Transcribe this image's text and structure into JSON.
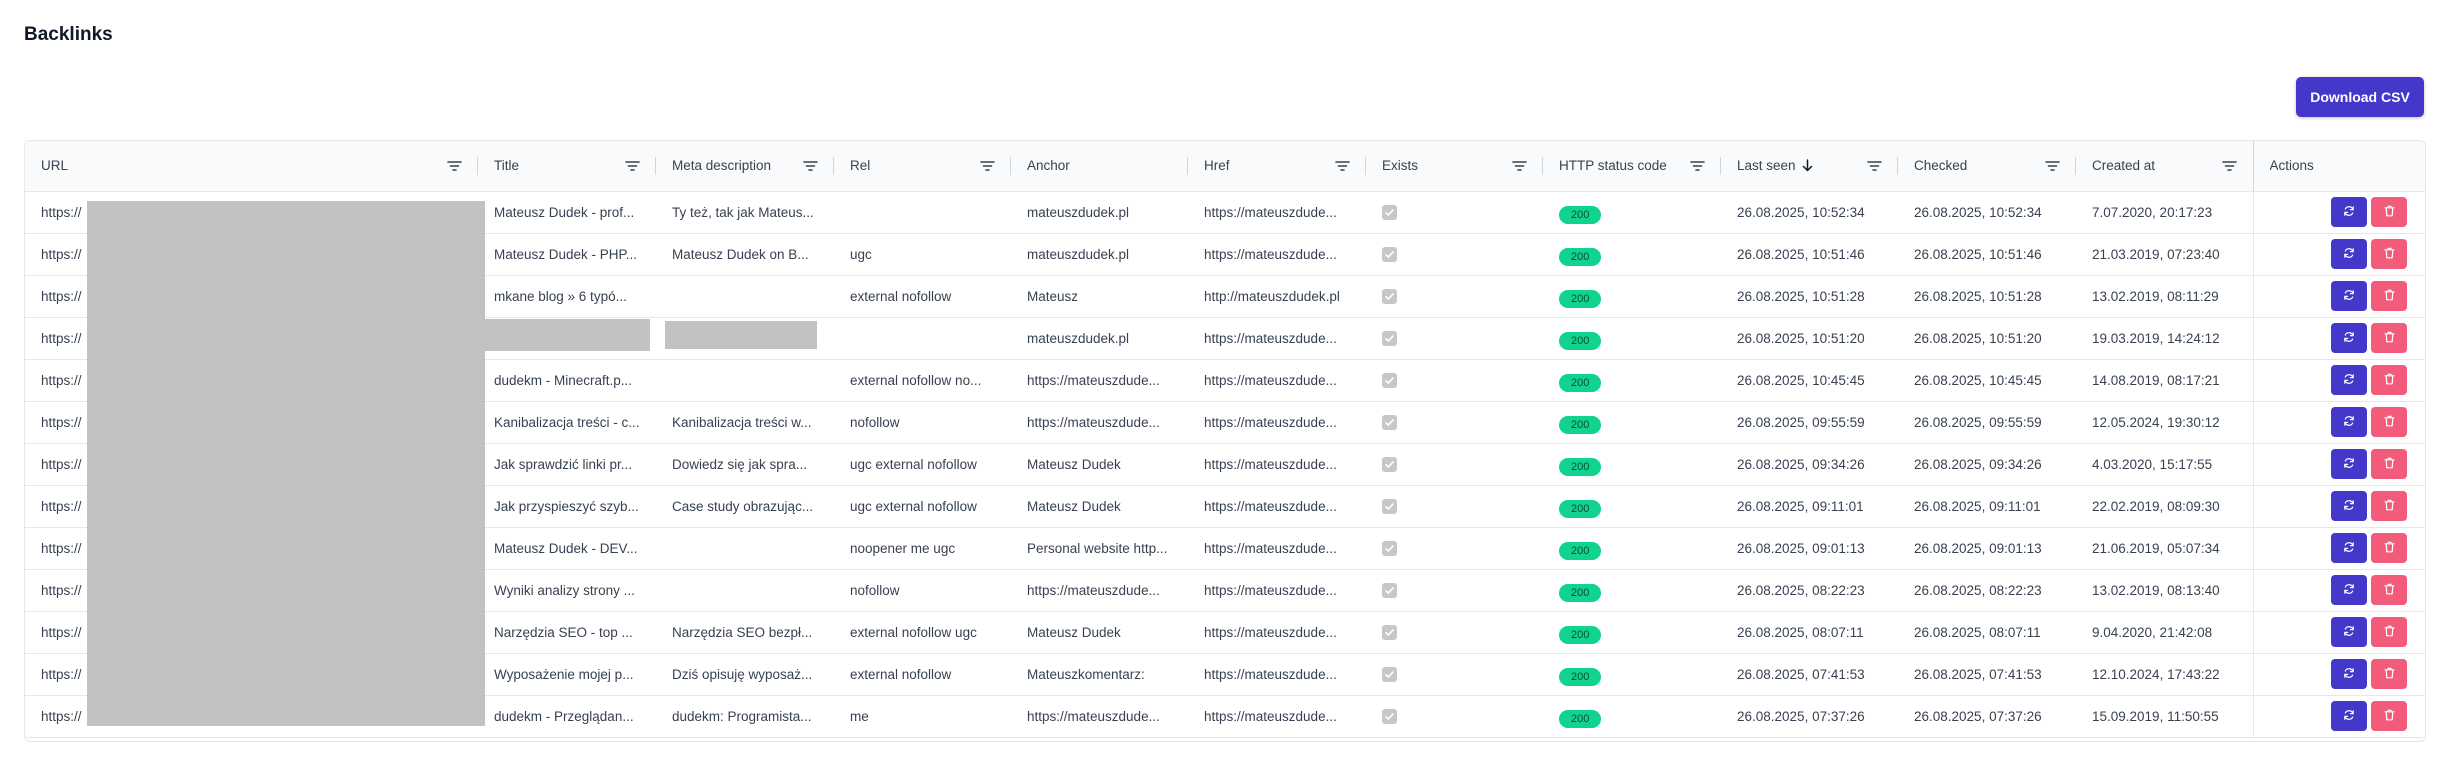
{
  "page": {
    "title": "Backlinks",
    "download_label": "Download CSV"
  },
  "colors": {
    "primary": "#4338ca",
    "danger": "#f25c7a",
    "status_ok": "#10d48e"
  },
  "columns": [
    {
      "key": "url",
      "label": "URL",
      "filter": true
    },
    {
      "key": "title",
      "label": "Title",
      "filter": true
    },
    {
      "key": "meta",
      "label": "Meta description",
      "filter": true
    },
    {
      "key": "rel",
      "label": "Rel",
      "filter": true
    },
    {
      "key": "anchor",
      "label": "Anchor",
      "filter": false
    },
    {
      "key": "href",
      "label": "Href",
      "filter": true
    },
    {
      "key": "exists",
      "label": "Exists",
      "filter": true
    },
    {
      "key": "status",
      "label": "HTTP status code",
      "filter": true
    },
    {
      "key": "last_seen",
      "label": "Last seen",
      "filter": true,
      "sort": "desc"
    },
    {
      "key": "checked",
      "label": "Checked",
      "filter": true
    },
    {
      "key": "created",
      "label": "Created at",
      "filter": true
    },
    {
      "key": "actions",
      "label": "Actions",
      "filter": false
    }
  ],
  "rows": [
    {
      "url": "https://",
      "title": "Mateusz Dudek - prof...",
      "meta": "Ty też, tak jak Mateus...",
      "rel": "",
      "anchor": "mateuszdudek.pl",
      "href": "https://mateuszdude...",
      "exists": true,
      "status": "200",
      "last_seen": "26.08.2025, 10:52:34",
      "checked": "26.08.2025, 10:52:34",
      "created": "7.07.2020, 20:17:23"
    },
    {
      "url": "https://",
      "title": "Mateusz Dudek - PHP...",
      "meta": "Mateusz Dudek on B...",
      "rel": "ugc",
      "anchor": "mateuszdudek.pl",
      "href": "https://mateuszdude...",
      "exists": true,
      "status": "200",
      "last_seen": "26.08.2025, 10:51:46",
      "checked": "26.08.2025, 10:51:46",
      "created": "21.03.2019, 07:23:40"
    },
    {
      "url": "https://",
      "title": "mkane blog » 6 typó...",
      "meta": "",
      "rel": "external nofollow",
      "anchor": "Mateusz",
      "href": "http://mateuszdudek.pl",
      "exists": true,
      "status": "200",
      "last_seen": "26.08.2025, 10:51:28",
      "checked": "26.08.2025, 10:51:28",
      "created": "13.02.2019, 08:11:29"
    },
    {
      "url": "https://",
      "title": "",
      "meta": "",
      "rel": "",
      "anchor": "mateuszdudek.pl",
      "href": "https://mateuszdude...",
      "exists": true,
      "status": "200",
      "last_seen": "26.08.2025, 10:51:20",
      "checked": "26.08.2025, 10:51:20",
      "created": "19.03.2019, 14:24:12"
    },
    {
      "url": "https://",
      "title": "dudekm - Minecraft.p...",
      "meta": "",
      "rel": "external nofollow no...",
      "anchor": "https://mateuszdude...",
      "href": "https://mateuszdude...",
      "exists": true,
      "status": "200",
      "last_seen": "26.08.2025, 10:45:45",
      "checked": "26.08.2025, 10:45:45",
      "created": "14.08.2019, 08:17:21"
    },
    {
      "url": "https://",
      "title": "Kanibalizacja treści - c...",
      "meta": "Kanibalizacja treści w...",
      "rel": "nofollow",
      "anchor": "https://mateuszdude...",
      "href": "https://mateuszdude...",
      "exists": true,
      "status": "200",
      "last_seen": "26.08.2025, 09:55:59",
      "checked": "26.08.2025, 09:55:59",
      "created": "12.05.2024, 19:30:12"
    },
    {
      "url": "https://",
      "title": "Jak sprawdzić linki pr...",
      "meta": "Dowiedz się jak spra...",
      "rel": "ugc external nofollow",
      "anchor": "Mateusz Dudek",
      "href": "https://mateuszdude...",
      "exists": true,
      "status": "200",
      "last_seen": "26.08.2025, 09:34:26",
      "checked": "26.08.2025, 09:34:26",
      "created": "4.03.2020, 15:17:55"
    },
    {
      "url": "https://",
      "title": "Jak przyspieszyć szyb...",
      "meta": "Case study obrazując...",
      "rel": "ugc external nofollow",
      "anchor": "Mateusz Dudek",
      "href": "https://mateuszdude...",
      "exists": true,
      "status": "200",
      "last_seen": "26.08.2025, 09:11:01",
      "checked": "26.08.2025, 09:11:01",
      "created": "22.02.2019, 08:09:30"
    },
    {
      "url": "https://",
      "title": "Mateusz Dudek - DEV...",
      "meta": "",
      "rel": "noopener me ugc",
      "anchor": "Personal website http...",
      "href": "https://mateuszdude...",
      "exists": true,
      "status": "200",
      "last_seen": "26.08.2025, 09:01:13",
      "checked": "26.08.2025, 09:01:13",
      "created": "21.06.2019, 05:07:34"
    },
    {
      "url": "https://",
      "title": "Wyniki analizy strony ...",
      "meta": "",
      "rel": "nofollow",
      "anchor": "https://mateuszdude...",
      "href": "https://mateuszdude...",
      "exists": true,
      "status": "200",
      "last_seen": "26.08.2025, 08:22:23",
      "checked": "26.08.2025, 08:22:23",
      "created": "13.02.2019, 08:13:40"
    },
    {
      "url": "https://",
      "title": "Narzędzia SEO - top ...",
      "meta": "Narzędzia SEO bezpł...",
      "rel": "external nofollow ugc",
      "anchor": "Mateusz Dudek",
      "href": "https://mateuszdude...",
      "exists": true,
      "status": "200",
      "last_seen": "26.08.2025, 08:07:11",
      "checked": "26.08.2025, 08:07:11",
      "created": "9.04.2020, 21:42:08"
    },
    {
      "url": "https://",
      "title": "Wyposażenie mojej p...",
      "meta": "Dziś opisuję wyposaż...",
      "rel": "external nofollow",
      "anchor": "Mateuszkomentarz:",
      "href": "https://mateuszdude...",
      "exists": true,
      "status": "200",
      "last_seen": "26.08.2025, 07:41:53",
      "checked": "26.08.2025, 07:41:53",
      "created": "12.10.2024, 17:43:22"
    },
    {
      "url": "https://",
      "title": "dudekm - Przeglądan...",
      "meta": "dudekm: Programista...",
      "rel": "me",
      "anchor": "https://mateuszdude...",
      "href": "https://mateuszdude...",
      "exists": true,
      "status": "200",
      "last_seen": "26.08.2025, 07:37:26",
      "checked": "26.08.2025, 07:37:26",
      "created": "15.09.2019, 11:50:55"
    }
  ]
}
